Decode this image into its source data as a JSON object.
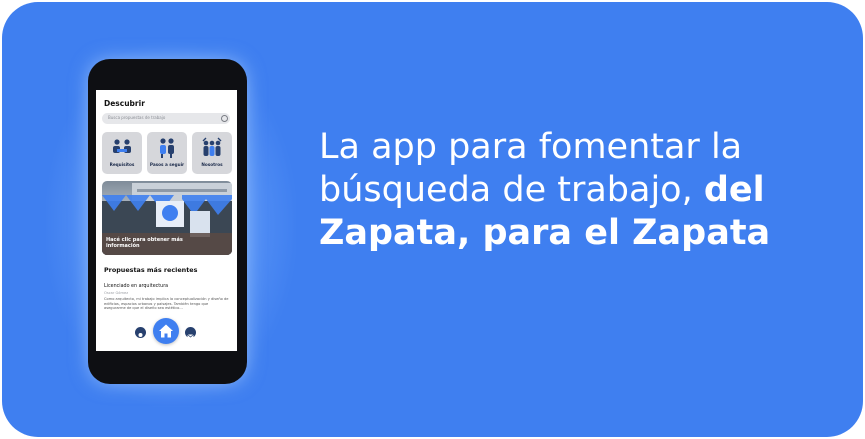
{
  "colors": {
    "banner": "#3f7ff0",
    "phone": "#0e0f13",
    "tile": "#d6d7db",
    "nav_icon": "#27406e",
    "accent": "#3f7ff0"
  },
  "app": {
    "title": "Descubrir",
    "search_placeholder": "Busca propuestas de trabajo",
    "tiles": [
      {
        "label": "Requisitos",
        "icon": "meeting-table-icon"
      },
      {
        "label": "Pasos a seguir",
        "icon": "people-group-icon"
      },
      {
        "label": "Nosotros",
        "icon": "team-hands-icon"
      }
    ],
    "hero_caption": "Hacé clic para obtener más información",
    "section_title": "Propuestas más recientes",
    "post": {
      "title": "Licenciado en arquitectura",
      "author": "Oscar Gómez",
      "body": "Como arquitecto, mi trabajo implica la conceptualización y diseño de edificios, espacios urbanos y paisajes. También tengo que asegurarme de que el diseño sea estético..."
    },
    "nav": [
      {
        "name": "profile",
        "icon": "user-icon"
      },
      {
        "name": "home",
        "icon": "home-icon"
      },
      {
        "name": "messages",
        "icon": "mail-icon"
      }
    ]
  },
  "headline": {
    "regular": "La app para fomentar la búsqueda de trabajo, ",
    "bold": "del Zapata, para el Zapata"
  }
}
